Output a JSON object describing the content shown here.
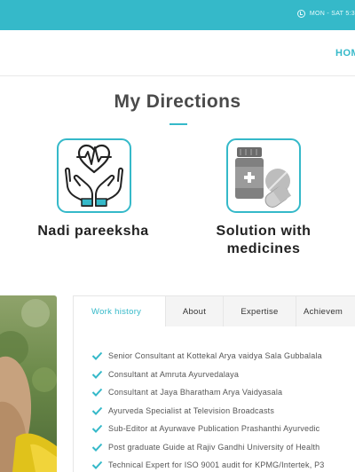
{
  "topbar": {
    "hours": "MON - SAT 5:3"
  },
  "nav": {
    "home": "HOM"
  },
  "section": {
    "title": "My Directions"
  },
  "services": [
    {
      "label": "Nadi pareeksha",
      "icon": "hands-heart-icon"
    },
    {
      "label": "Solution with medicines",
      "icon": "medicine-bottle-pills-icon"
    }
  ],
  "tabs": [
    {
      "label": "Work history",
      "active": true
    },
    {
      "label": "About"
    },
    {
      "label": "Expertise"
    },
    {
      "label": "Achievem"
    }
  ],
  "work_history": [
    "Senior Consultant at Kottekal Arya vaidya Sala Gubbalala",
    "Consultant at Amruta Ayurvedalaya",
    "Consultant at Jaya Bharatham Arya Vaidyasala",
    "Ayurveda Specialist at Television Broadcasts",
    "Sub-Editor at Ayurwave Publication Prashanthi Ayurvedic",
    "Post graduate Guide at Rajiv Gandhi University of Health",
    "Technical Expert for ISO 9001 audit for KPMG/Intertek, P3"
  ],
  "colors": {
    "accent": "#35b9c9",
    "check": "#35b9c9"
  }
}
